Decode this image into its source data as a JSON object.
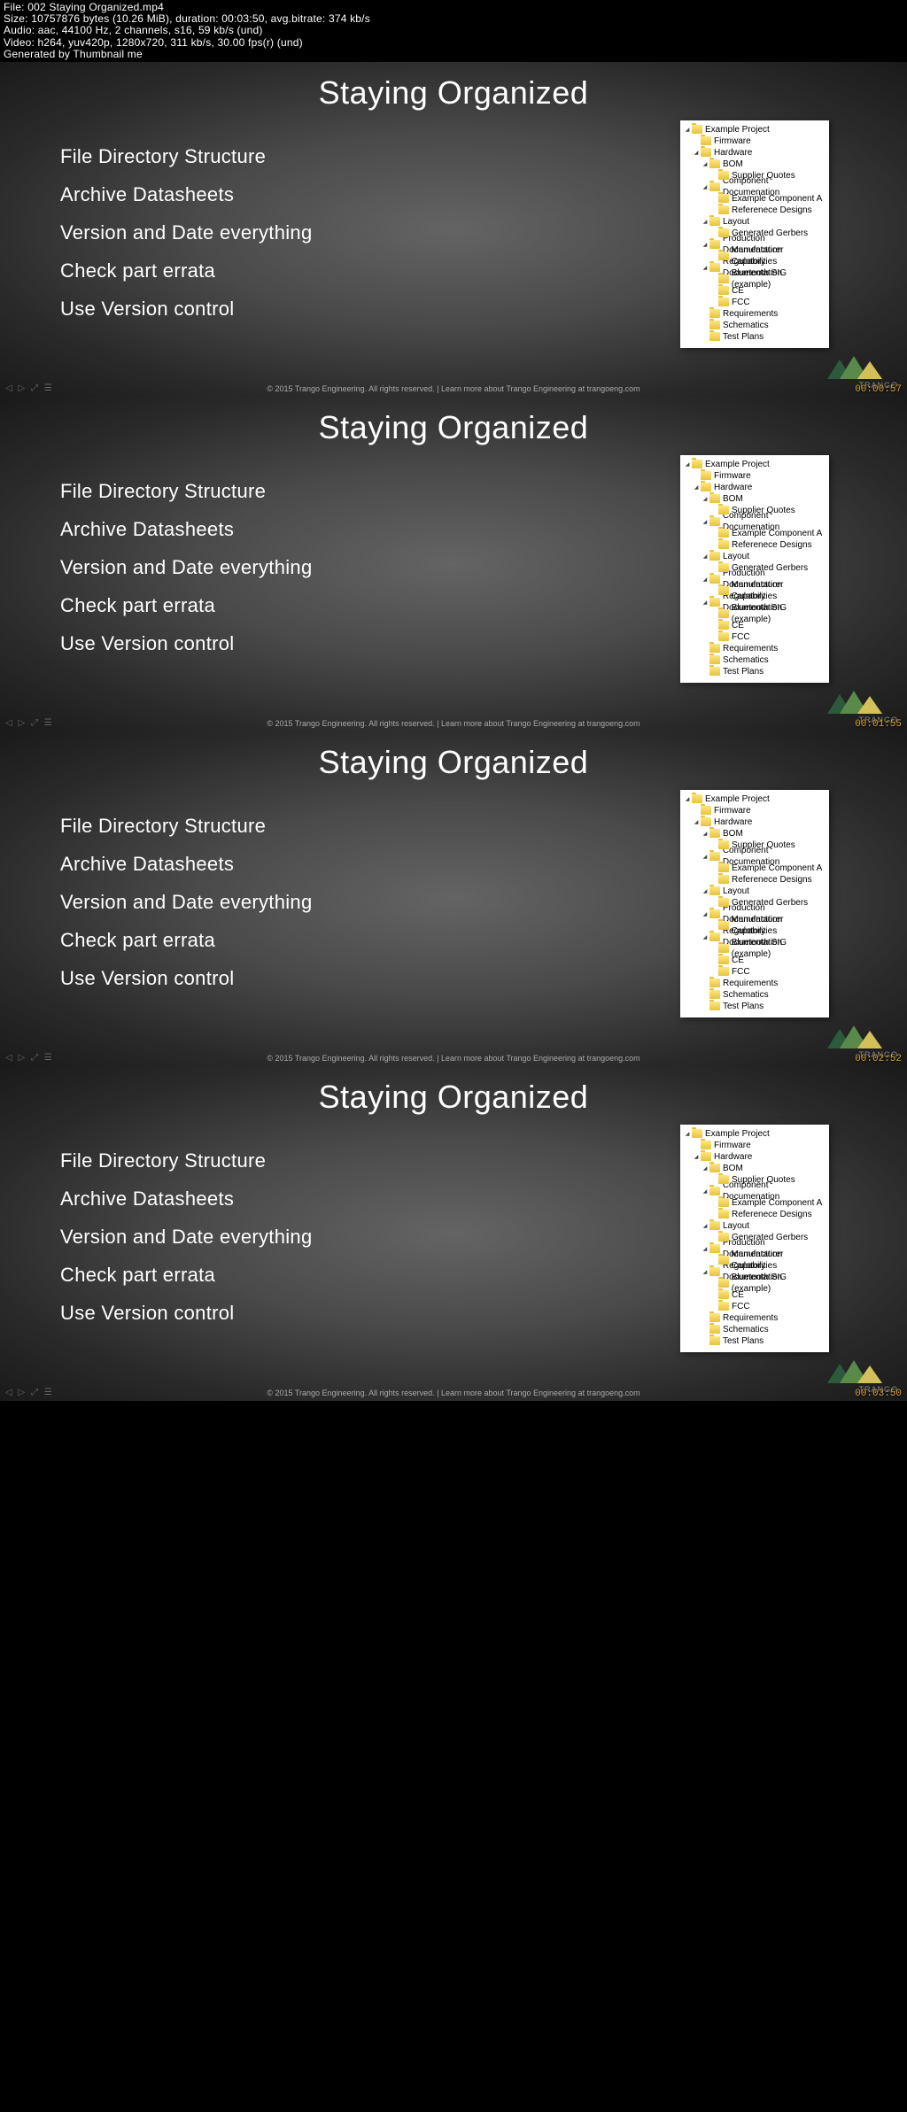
{
  "meta": {
    "line1": "File: 002 Staying Organized.mp4",
    "line2": "Size: 10757876 bytes (10.26 MiB), duration: 00:03:50, avg.bitrate: 374 kb/s",
    "line3": "Audio: aac, 44100 Hz, 2 channels, s16, 59 kb/s (und)",
    "line4": "Video: h264, yuv420p, 1280x720, 311 kb/s, 30.00 fps(r) (und)",
    "line5": "Generated by Thumbnail me"
  },
  "slide": {
    "title": "Staying Organized",
    "bullets": [
      "File Directory Structure",
      "Archive Datasheets",
      "Version and Date everything",
      "Check part errata",
      "Use Version control"
    ],
    "footer": "© 2015 Trango Engineering. All rights reserved.  |  Learn more about Trango Engineering at trangoeng.com",
    "logo_text": "TRANGO"
  },
  "tree": [
    {
      "indent": 0,
      "toggle": "open",
      "label": "Example Project"
    },
    {
      "indent": 1,
      "toggle": "none",
      "label": "Firmware"
    },
    {
      "indent": 1,
      "toggle": "open",
      "label": "Hardware"
    },
    {
      "indent": 2,
      "toggle": "open",
      "label": "BOM"
    },
    {
      "indent": 3,
      "toggle": "none",
      "label": "Supplier Quotes"
    },
    {
      "indent": 2,
      "toggle": "open",
      "label": "Component Documenation"
    },
    {
      "indent": 3,
      "toggle": "none",
      "label": "Example Component A"
    },
    {
      "indent": 3,
      "toggle": "none",
      "label": "Referenece Designs"
    },
    {
      "indent": 2,
      "toggle": "open",
      "label": "Layout"
    },
    {
      "indent": 3,
      "toggle": "none",
      "label": "Generated Gerbers"
    },
    {
      "indent": 2,
      "toggle": "open",
      "label": "Production Documentation"
    },
    {
      "indent": 3,
      "toggle": "none",
      "label": "Manufacturer Capabilities"
    },
    {
      "indent": 2,
      "toggle": "open",
      "label": "Regulatory Documentation"
    },
    {
      "indent": 3,
      "toggle": "none",
      "label": "Bluetooth SIG (example)"
    },
    {
      "indent": 3,
      "toggle": "none",
      "label": "CE"
    },
    {
      "indent": 3,
      "toggle": "none",
      "label": "FCC"
    },
    {
      "indent": 2,
      "toggle": "none",
      "label": "Requirements"
    },
    {
      "indent": 2,
      "toggle": "none",
      "label": "Schematics"
    },
    {
      "indent": 2,
      "toggle": "none",
      "label": "Test Plans"
    }
  ],
  "timestamps": [
    "00:00:57",
    "00:01:55",
    "00:02:52",
    "00:03:50"
  ]
}
